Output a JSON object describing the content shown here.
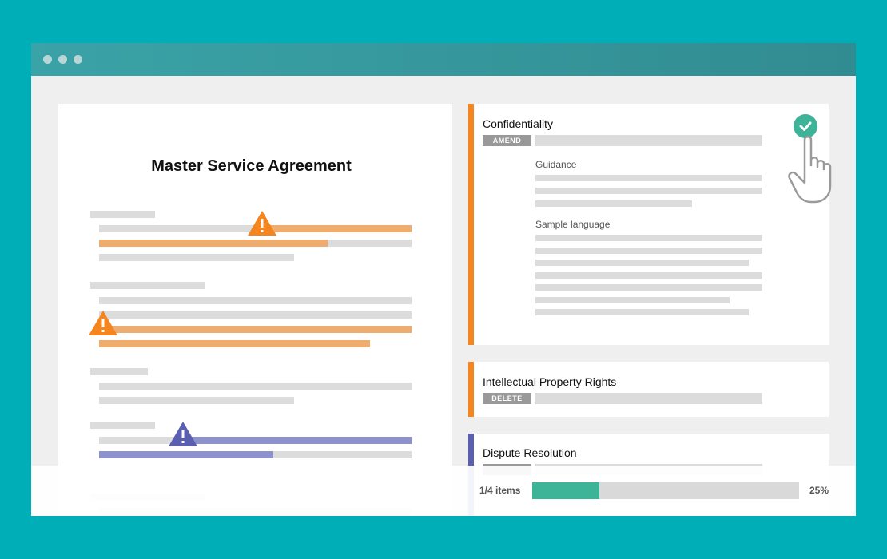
{
  "document": {
    "title": "Master Service Agreement"
  },
  "cards": [
    {
      "title": "Confidentiality",
      "tag": "AMEND",
      "accent": "#F4851F",
      "guidance_label": "Guidance",
      "sample_label": "Sample language"
    },
    {
      "title": "Intellectual Property Rights",
      "tag": "DELETE",
      "accent": "#F4851F"
    },
    {
      "title": "Dispute Resolution",
      "accent": "#5A5FB0"
    }
  ],
  "progress": {
    "count_label": "1/4 items",
    "percent_label": "25%",
    "fraction": 0.25,
    "fill_color": "#3DB398"
  },
  "icons": {
    "warning_orange": "warning-icon",
    "warning_purple": "warning-icon",
    "check": "check-circle-icon",
    "cursor": "hand-pointer-icon"
  },
  "colors": {
    "background": "#00AEB7",
    "orange": "#F4851F",
    "purple": "#5A5FB0",
    "green": "#3DB398"
  }
}
